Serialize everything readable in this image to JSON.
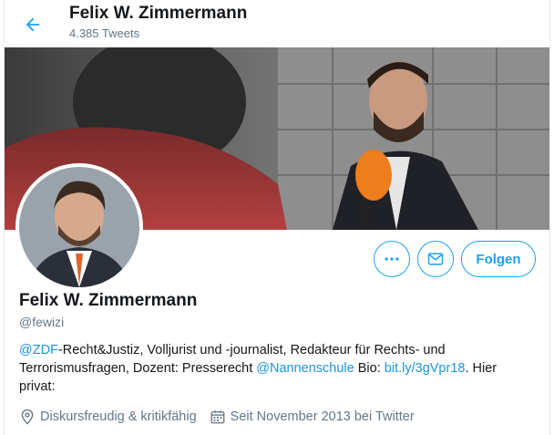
{
  "header": {
    "name": "Felix W. Zimmermann",
    "tweet_count": "4.385 Tweets"
  },
  "actions": {
    "more_label": "...",
    "follow_label": "Folgen"
  },
  "profile": {
    "name": "Felix W. Zimmermann",
    "handle": "@fewizi",
    "bio": {
      "mention1": "@ZDF",
      "text1": "-Recht&Justiz, Volljurist und -journalist, Redakteur für Rechts- und Terrorismusfragen, Dozent: Presserecht ",
      "mention2": "@Nannenschule",
      "text2": " Bio: ",
      "link": "bit.ly/3gVpr18",
      "text3": ". Hier privat:"
    },
    "location": "Diskursfreudig & kritikfähig",
    "joined": "Seit November 2013 bei Twitter"
  },
  "icons": {
    "back": "arrow-left-icon",
    "more": "more-dots-icon",
    "message": "envelope-icon",
    "location": "location-pin-icon",
    "calendar": "calendar-icon"
  },
  "colors": {
    "accent": "#1da1f2",
    "link": "#1b95e0",
    "secondary_text": "#657786"
  }
}
